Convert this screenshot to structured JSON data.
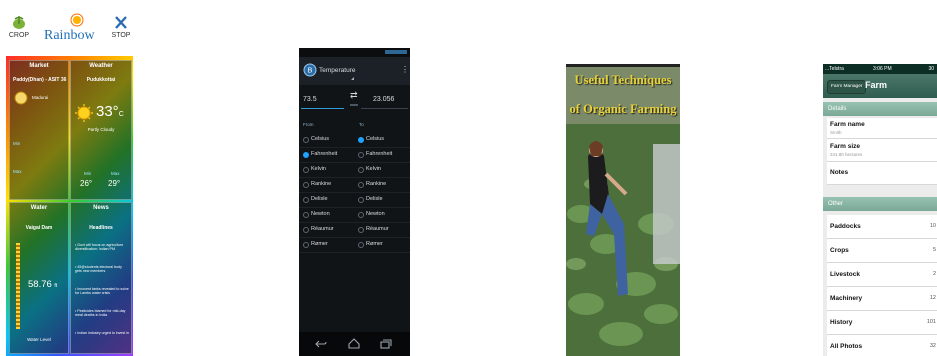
{
  "rainbow": {
    "crop": "CROP",
    "logo": "Rainbow",
    "stop": "STOP",
    "market": {
      "title": "Market",
      "commodity": "Paddy(Dhan) - ASIT 36",
      "market_name": "Madurai",
      "min_label": "Min",
      "max_label": "Max"
    },
    "weather": {
      "title": "Weather",
      "place": "Pudukkottai",
      "temp": "33°",
      "unit": "C",
      "condition": "Partly Cloudy",
      "min_label": "Min",
      "max_label": "Max",
      "min_temp": "26°",
      "max_temp": "29°"
    },
    "water": {
      "title": "Water",
      "dam": "Vaigai Dam",
      "level": "58.76",
      "unit": "ft",
      "caption": "Water Level"
    },
    "news": {
      "title": "News",
      "subtitle": "Headlines",
      "items": [
        "Govt will focus on agriculture diversification: Indian PM",
        "45@students electoral body gets new members",
        "Innocent tanks revealed to solve for Lambs water crisis",
        "Pesticides blamed for mid-day meal deaths in India",
        "Indian industry urged to invest in"
      ]
    }
  },
  "converter": {
    "title": "Temperature",
    "from_value": "73.5",
    "to_value": "23.056",
    "from_label": "From",
    "to_label": "To",
    "units": [
      "Celsius",
      "Fahrenheit",
      "Kelvin",
      "Rankine",
      "Delisle",
      "Newton",
      "Réaumur",
      "Rømer"
    ],
    "from_selected": "Fahrenheit",
    "to_selected": "Celsius"
  },
  "organic": {
    "title_line1": "Useful Techniques",
    "title_line2": "of Organic Farming"
  },
  "farm": {
    "carrier": "...Telstra",
    "time": "3:06 PM",
    "battery": "30",
    "back": "Farm Manager",
    "title": "Farm",
    "section_details": "Details",
    "section_other": "Other",
    "farm_name_label": "Farm name",
    "farm_name_value": "Smith",
    "farm_size_label": "Farm size",
    "farm_size_value": "341.80 hectares",
    "notes_label": "Notes",
    "rows": [
      {
        "label": "Paddocks",
        "count": "10"
      },
      {
        "label": "Crops",
        "count": "5"
      },
      {
        "label": "Livestock",
        "count": "2"
      },
      {
        "label": "Machinery",
        "count": "12"
      },
      {
        "label": "History",
        "count": "101"
      },
      {
        "label": "All Photos",
        "count": "32"
      }
    ]
  }
}
